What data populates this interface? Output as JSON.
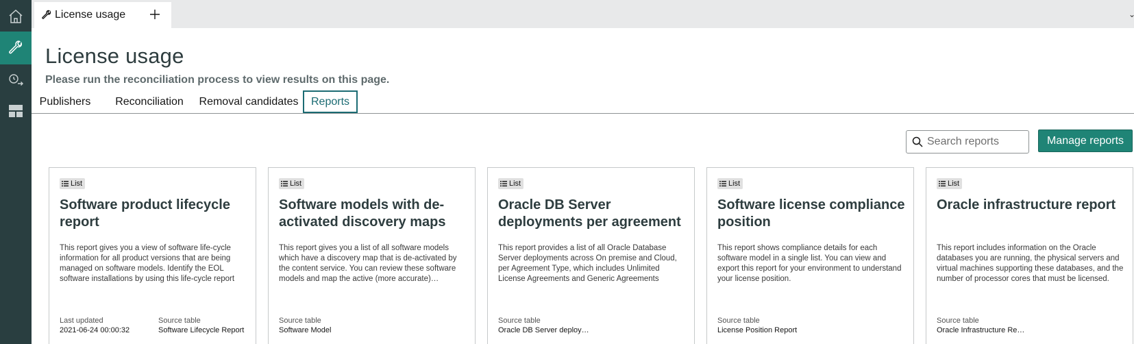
{
  "tab": {
    "label": "License usage",
    "icon": "wrench-icon"
  },
  "page": {
    "title": "License usage",
    "subtitle": "Please run the reconciliation process to view results on this page."
  },
  "nav_tabs": [
    {
      "label": "Publishers"
    },
    {
      "label": "Reconciliation"
    },
    {
      "label": "Removal candidates"
    },
    {
      "label": "Reports",
      "active": true
    }
  ],
  "search": {
    "placeholder": "Search reports"
  },
  "manage_button": {
    "label": "Manage reports"
  },
  "cards": [
    {
      "chip": "List",
      "title": "Software product lifecycle report",
      "description": "This report gives you a view of software life-cycle information for all product versions that are being managed on software models. Identify the EOL software installations by using this life-cycle report",
      "last_updated_label": "Last updated",
      "last_updated_value": "2021-06-24 00:00:32",
      "source_label": "Source table",
      "source_value": "Software Lifecycle Report"
    },
    {
      "chip": "List",
      "title": "Software models with de-activated discovery maps",
      "description": "This report gives you a list of all software models which have a discovery map that is de-activated by the content service. You can review these software models and map the active (more accurate) discove…",
      "source_label": "Source table",
      "source_value": "Software Model"
    },
    {
      "chip": "List",
      "title": "Oracle DB Server deployments per agreement",
      "description": "This report provides a list of all Oracle Database Server deployments across On premise and Cloud, per Agreement Type, which includes Unlimited License Agreements and Generic Agreements",
      "source_label": "Source table",
      "source_value": "Oracle DB Server deploy…"
    },
    {
      "chip": "List",
      "title": "Software license compliance position",
      "description": "This report shows compliance details for each software model in a single list. You can view and export this report for your environment to understand your license position.",
      "source_label": "Source table",
      "source_value": "License Position Report"
    },
    {
      "chip": "List",
      "title": "Oracle infrastructure report",
      "description": "This report includes information on the Oracle databases you are running, the physical servers and virtual machines supporting these databases, and the number of processor cores that must be licensed.",
      "source_label": "Source table",
      "source_value": "Oracle Infrastructure Re…"
    }
  ],
  "colors": {
    "rail": "#293e40",
    "accent": "#1f8476",
    "active_tab_border": "#1b6b73"
  }
}
